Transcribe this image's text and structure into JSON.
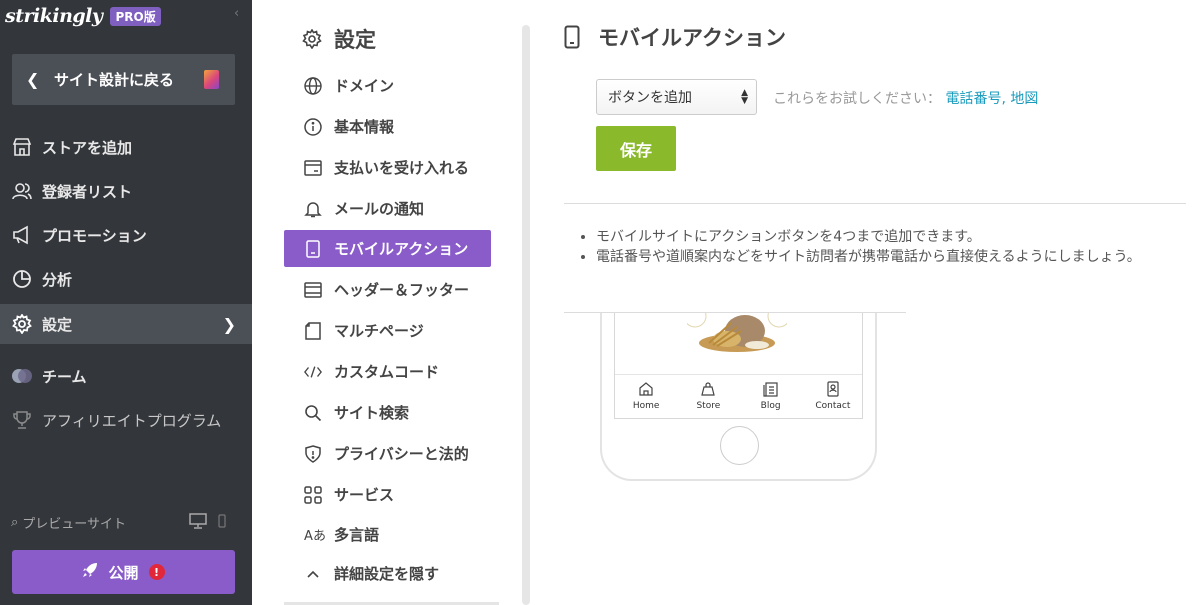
{
  "brand": {
    "name": "strikingly",
    "badge": "PRO版"
  },
  "sidebar": {
    "back_label": "サイト設計に戻る",
    "items": [
      {
        "label": "ストアを追加",
        "icon": "store-icon"
      },
      {
        "label": "登録者リスト",
        "icon": "users-icon"
      },
      {
        "label": "プロモーション",
        "icon": "megaphone-icon"
      },
      {
        "label": "分析",
        "icon": "pie-chart-icon"
      },
      {
        "label": "設定",
        "icon": "gear-icon",
        "active": true
      },
      {
        "label": "チーム",
        "icon": "team-icon"
      },
      {
        "label": "アフィリエイトプログラム",
        "icon": "trophy-icon"
      }
    ],
    "preview_label": "プレビューサイト",
    "publish_label": "公開",
    "publish_alert": "!"
  },
  "settings": {
    "title": "設定",
    "items": [
      {
        "label": "ドメイン",
        "icon": "globe-icon"
      },
      {
        "label": "基本情報",
        "icon": "info-icon"
      },
      {
        "label": "支払いを受け入れる",
        "icon": "payment-icon"
      },
      {
        "label": "メールの通知",
        "icon": "bell-icon"
      },
      {
        "label": "モバイルアクション",
        "icon": "mobile-icon",
        "active": true
      },
      {
        "label": "ヘッダー＆フッター",
        "icon": "header-footer-icon"
      },
      {
        "label": "マルチページ",
        "icon": "pages-icon"
      },
      {
        "label": "カスタムコード",
        "icon": "code-icon"
      },
      {
        "label": "サイト検索",
        "icon": "search-icon"
      },
      {
        "label": "プライバシーと法的",
        "icon": "shield-icon"
      },
      {
        "label": "サービス",
        "icon": "grid-icon"
      },
      {
        "label": "多言語",
        "icon": "language-icon"
      },
      {
        "label": "詳細設定を隠す",
        "icon": "chevron-up-icon"
      }
    ]
  },
  "main": {
    "title": "モバイルアクション",
    "select_value": "ボタンを追加",
    "hint_prefix": "これらをお試しください：",
    "hint_link_phone": "電話番号,",
    "hint_link_map": "地図",
    "save_label": "保存",
    "info": [
      "モバイルサイトにアクションボタンを4つまで追加できます。",
      "電話番号や道順案内などをサイト訪問者が携帯電話から直接使えるようにしましょう。"
    ],
    "phone_tabs": [
      "Home",
      "Store",
      "Blog",
      "Contact"
    ]
  },
  "colors": {
    "sidebar_bg": "#33363b",
    "accent_purple": "#8a5cc9",
    "save_green": "#8ab92b",
    "link_blue": "#1a9bbd",
    "alert_red": "#e0283a"
  }
}
